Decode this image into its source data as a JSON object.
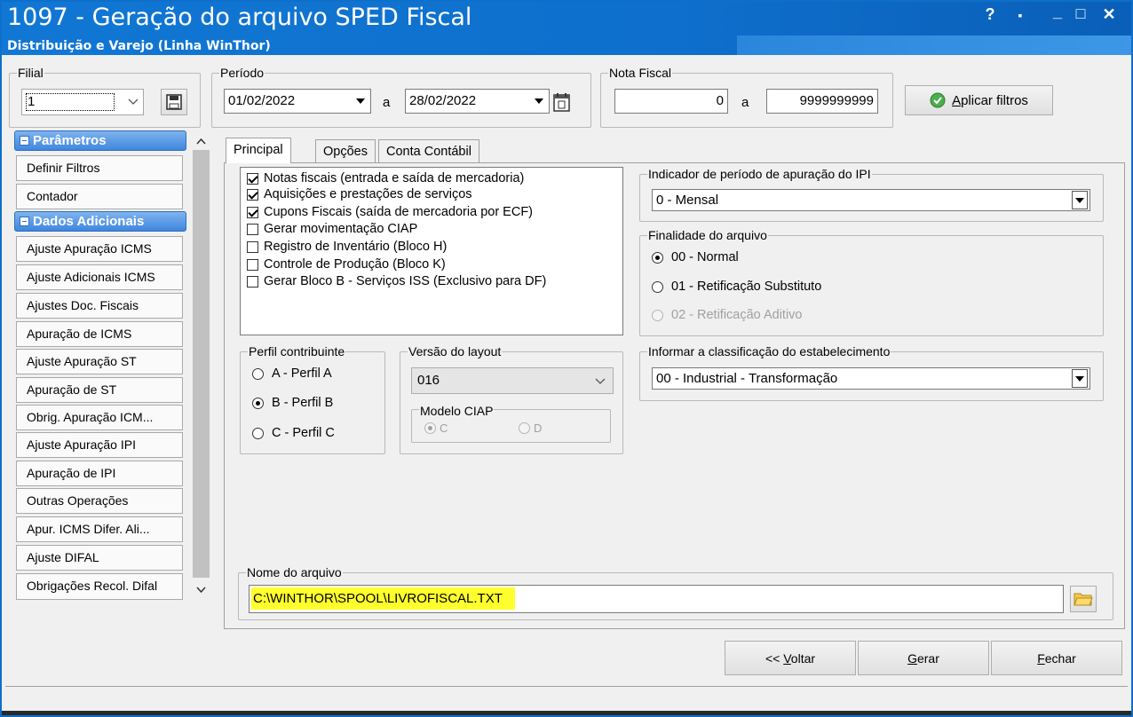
{
  "window": {
    "title": "1097 - Geração do arquivo SPED Fiscal",
    "subtitle": "Distribuição e Varejo (Linha WinThor)",
    "help": "?",
    "restore": "▪",
    "minimize": "_",
    "maximize": "□",
    "close": "✕"
  },
  "filial": {
    "label": "Filial",
    "value": "1"
  },
  "periodo": {
    "label": "Período",
    "start": "01/02/2022",
    "sep": "a",
    "end": "28/02/2022"
  },
  "nota_fiscal": {
    "label": "Nota Fiscal",
    "start": "0",
    "sep": "a",
    "end": "9999999999"
  },
  "apply_filters": {
    "underlined": "A",
    "rest": "plicar filtros"
  },
  "sidebar": {
    "group1": "Parâmetros",
    "group1_items": [
      "Definir Filtros",
      "Contador"
    ],
    "group2": "Dados Adicionais",
    "group2_items": [
      "Ajuste Apuração ICMS",
      "Ajuste Adicionais ICMS",
      "Ajustes Doc. Fiscais",
      "Apuração de ICMS",
      "Ajuste Apuração ST",
      "Apuração de ST",
      "Obrig. Apuração ICM...",
      "Ajuste Apuração IPI",
      "Apuração de IPI",
      "Outras Operações",
      "Apur. ICMS Difer. Ali...",
      "Ajuste DIFAL",
      "Obrigações Recol. Difal"
    ]
  },
  "tabs": [
    "Principal",
    "Opções",
    "Conta Contábil"
  ],
  "checks": [
    {
      "label": "Notas fiscais (entrada e saída de mercadoria)",
      "checked": true
    },
    {
      "label": "Aquisições e prestações de serviços",
      "checked": true
    },
    {
      "label": "Cupons Fiscais (saída de mercadoria por ECF)",
      "checked": true
    },
    {
      "label": "Gerar movimentação CIAP",
      "checked": false
    },
    {
      "label": "Registro de Inventário (Bloco H)",
      "checked": false
    },
    {
      "label": "Controle de Produção (Bloco K)",
      "checked": false
    },
    {
      "label": "Gerar Bloco B - Serviços ISS (Exclusivo para DF)",
      "checked": false
    }
  ],
  "ipi": {
    "label": "Indicador de período de apuração do IPI",
    "value": "0 - Mensal"
  },
  "finalidade": {
    "label": "Finalidade do arquivo",
    "options": [
      {
        "label": "00 - Normal",
        "selected": true,
        "disabled": false
      },
      {
        "label": "01 - Retificação Substituto",
        "selected": false,
        "disabled": false
      },
      {
        "label": "02 - Retificação Aditivo",
        "selected": false,
        "disabled": true
      }
    ]
  },
  "perfil": {
    "label": "Perfil contribuinte",
    "options": [
      {
        "label": "A - Perfil A",
        "selected": false
      },
      {
        "label": "B - Perfil B",
        "selected": true
      },
      {
        "label": "C - Perfil C",
        "selected": false
      }
    ]
  },
  "versao": {
    "label": "Versão do layout",
    "value": "016"
  },
  "ciap": {
    "label": "Modelo CIAP",
    "opt_c": "C",
    "opt_d": "D"
  },
  "classificacao": {
    "label": "Informar a classificação do estabelecimento",
    "value": "00 - Industrial - Transformação"
  },
  "arquivo": {
    "label": "Nome do arquivo",
    "value": "C:\\WINTHOR\\SPOOL\\LIVROFISCAL.TXT"
  },
  "buttons": {
    "voltar_pre": "<< ",
    "voltar_u": "V",
    "voltar_rest": "oltar",
    "gerar_u": "G",
    "gerar_rest": "erar",
    "fechar_u": "F",
    "fechar_rest": "echar"
  },
  "colors": {
    "titlebar": "#1177d4",
    "sidebar_header": "#3f86de",
    "highlight": "#ffff2e"
  }
}
